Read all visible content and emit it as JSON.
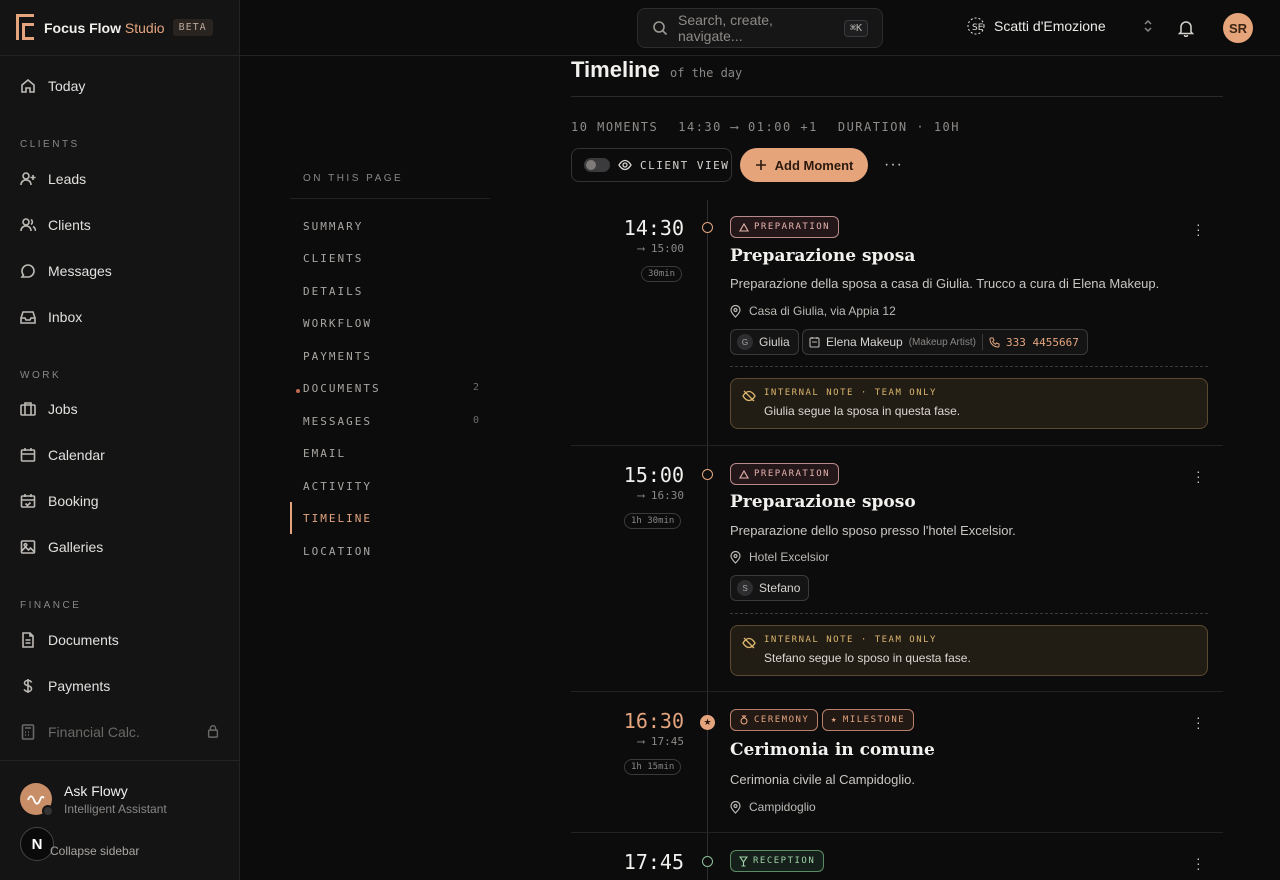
{
  "brand": {
    "name": "Focus Flow",
    "accent": "Studio",
    "badge": "BETA"
  },
  "search": {
    "placeholder": "Search, create, navigate...",
    "shortcut": "⌘K"
  },
  "studio": {
    "name": "Scatti d'Emozione"
  },
  "user": {
    "initials": "SR"
  },
  "sidebar": {
    "today": "Today",
    "clients_label": "CLIENTS",
    "leads": "Leads",
    "clients": "Clients",
    "messages": "Messages",
    "inbox": "Inbox",
    "work_label": "WORK",
    "jobs": "Jobs",
    "calendar": "Calendar",
    "booking": "Booking",
    "galleries": "Galleries",
    "finance_label": "FINANCE",
    "documents": "Documents",
    "payments": "Payments",
    "financial_calc": "Financial Calc.",
    "ask_title": "Ask Flowy",
    "ask_sub": "Intelligent Assistant",
    "n_label": "N",
    "collapse": "Collapse sidebar"
  },
  "toc": {
    "title": "ON THIS PAGE",
    "items": [
      "SUMMARY",
      "CLIENTS",
      "DETAILS",
      "WORKFLOW",
      "PAYMENTS",
      "DOCUMENTS",
      "MESSAGES",
      "EMAIL",
      "ACTIVITY",
      "TIMELINE",
      "LOCATION"
    ],
    "documents_count": "2",
    "messages_count": "0"
  },
  "main": {
    "title": "Timeline",
    "subtitle": "of the day",
    "stats": {
      "moments": "10 MOMENTS",
      "range": "14:30 ⟶ 01:00 +1",
      "duration": "DURATION · 10H"
    },
    "client_view": "CLIENT VIEW",
    "add_moment": "Add Moment",
    "more": "···"
  },
  "moments": [
    {
      "start": "14:30",
      "end": "⟶ 15:00",
      "duration": "30min",
      "tag": "PREPARATION",
      "title": "Preparazione sposa",
      "desc": "Preparazione della sposa a casa di Giulia. Trucco a cura di Elena Makeup.",
      "location": "Casa di Giulia, via Appia 12",
      "chip1_initial": "G",
      "chip1_name": "Giulia",
      "chip2_name": "Elena Makeup",
      "chip2_role": "(Makeup Artist)",
      "chip2_phone": "333 4455667",
      "note_label": "INTERNAL NOTE · TEAM ONLY",
      "note_text": "Giulia segue la sposa in questa fase."
    },
    {
      "start": "15:00",
      "end": "⟶ 16:30",
      "duration": "1h 30min",
      "tag": "PREPARATION",
      "title": "Preparazione sposo",
      "desc": "Preparazione dello sposo presso l'hotel Excelsior.",
      "location": "Hotel Excelsior",
      "chip1_initial": "S",
      "chip1_name": "Stefano",
      "note_label": "INTERNAL NOTE · TEAM ONLY",
      "note_text": "Stefano segue lo sposo in questa fase."
    },
    {
      "start": "16:30",
      "end": "⟶ 17:45",
      "duration": "1h 15min",
      "tag": "CEREMONY",
      "tag2": "MILESTONE",
      "title": "Cerimonia in comune",
      "desc": "Cerimonia civile al Campidoglio.",
      "location": "Campidoglio"
    },
    {
      "start": "17:45",
      "tag": "RECEPTION"
    }
  ],
  "colors": {
    "accent": "#e4a57e",
    "background": "#0c0c0d",
    "sidebar": "#141415",
    "note": "#d9b46e",
    "green": "#9fd0a9"
  }
}
